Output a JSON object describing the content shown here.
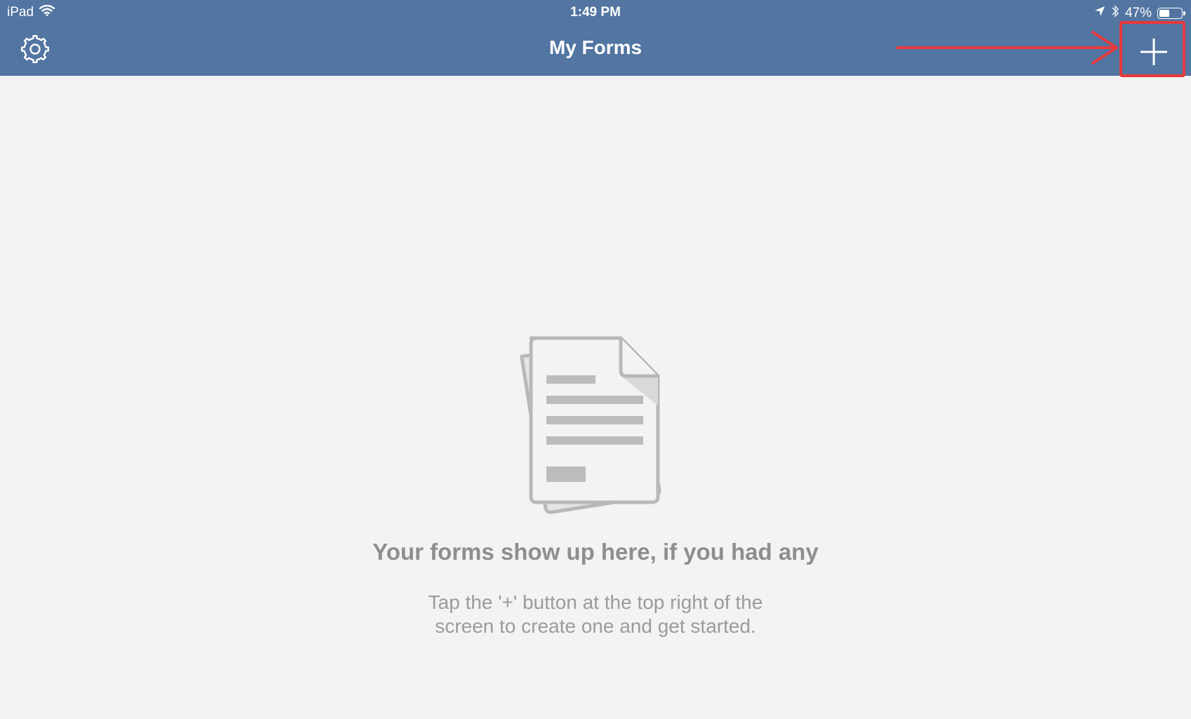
{
  "status_bar": {
    "device": "iPad",
    "time": "1:49 PM",
    "battery_percent": "47%",
    "battery_level": 0.47
  },
  "navbar": {
    "title": "My Forms",
    "background_color": "#5275a2",
    "left_icon": "gear-icon",
    "right_icon": "plus-icon"
  },
  "annotation": {
    "highlight_color": "#e8383b",
    "arrow_icon": "arrow-right-icon"
  },
  "empty_state": {
    "illustration_icon": "document-stack-icon",
    "title": "Your forms show up here, if you had any",
    "subtitle_line1": "Tap the '+' button at the top right of the",
    "subtitle_line2": "screen to create one and get started."
  }
}
